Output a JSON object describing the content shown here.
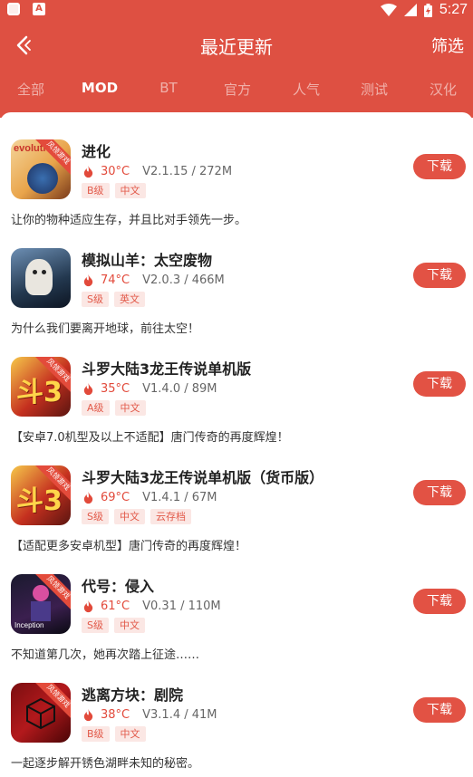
{
  "colors": {
    "accent": "#de5042",
    "download": "#e25244",
    "temp": "#e24a3b"
  },
  "status_bar": {
    "time": "5:27"
  },
  "header": {
    "title": "最近更新",
    "filter_label": "筛选"
  },
  "tabs": [
    {
      "label": "全部",
      "active": false
    },
    {
      "label": "MOD",
      "active": true
    },
    {
      "label": "BT",
      "active": false
    },
    {
      "label": "官方",
      "active": false
    },
    {
      "label": "人气",
      "active": false
    },
    {
      "label": "测试",
      "active": false
    },
    {
      "label": "汉化",
      "active": false
    }
  ],
  "badge_text": "风领游戏",
  "download_label": "下载",
  "games": [
    {
      "name": "进化",
      "temp": "30°C",
      "version": "V2.1.15 / 272M",
      "tags": [
        "B级",
        "中文"
      ],
      "desc": "让你的物种适应生存，并且比对手领先一步。",
      "icon_text": "evolution"
    },
    {
      "name": "模拟山羊：太空废物",
      "temp": "74°C",
      "version": "V2.0.3 / 466M",
      "tags": [
        "S级",
        "英文"
      ],
      "desc": "为什么我们要离开地球，前往太空！",
      "icon_text": ""
    },
    {
      "name": "斗罗大陆3龙王传说单机版",
      "temp": "35°C",
      "version": "V1.4.0 / 89M",
      "tags": [
        "A级",
        "中文"
      ],
      "desc": "【安卓7.0机型及以上不适配】唐门传奇的再度辉煌！",
      "icon_text": "斗3"
    },
    {
      "name": "斗罗大陆3龙王传说单机版（货币版）",
      "temp": "69°C",
      "version": "V1.4.1 / 67M",
      "tags": [
        "S级",
        "中文",
        "云存档"
      ],
      "desc": "【适配更多安卓机型】唐门传奇的再度辉煌！",
      "icon_text": "斗3"
    },
    {
      "name": "代号：侵入",
      "temp": "61°C",
      "version": "V0.31 / 110M",
      "tags": [
        "S级",
        "中文"
      ],
      "desc": "不知道第几次，她再次踏上征途……",
      "icon_text": "Inception"
    },
    {
      "name": "逃离方块：剧院",
      "temp": "38°C",
      "version": "V3.1.4 / 41M",
      "tags": [
        "B级",
        "中文"
      ],
      "desc": "一起逐步解开锈色湖畔未知的秘密。",
      "icon_text": ""
    }
  ]
}
